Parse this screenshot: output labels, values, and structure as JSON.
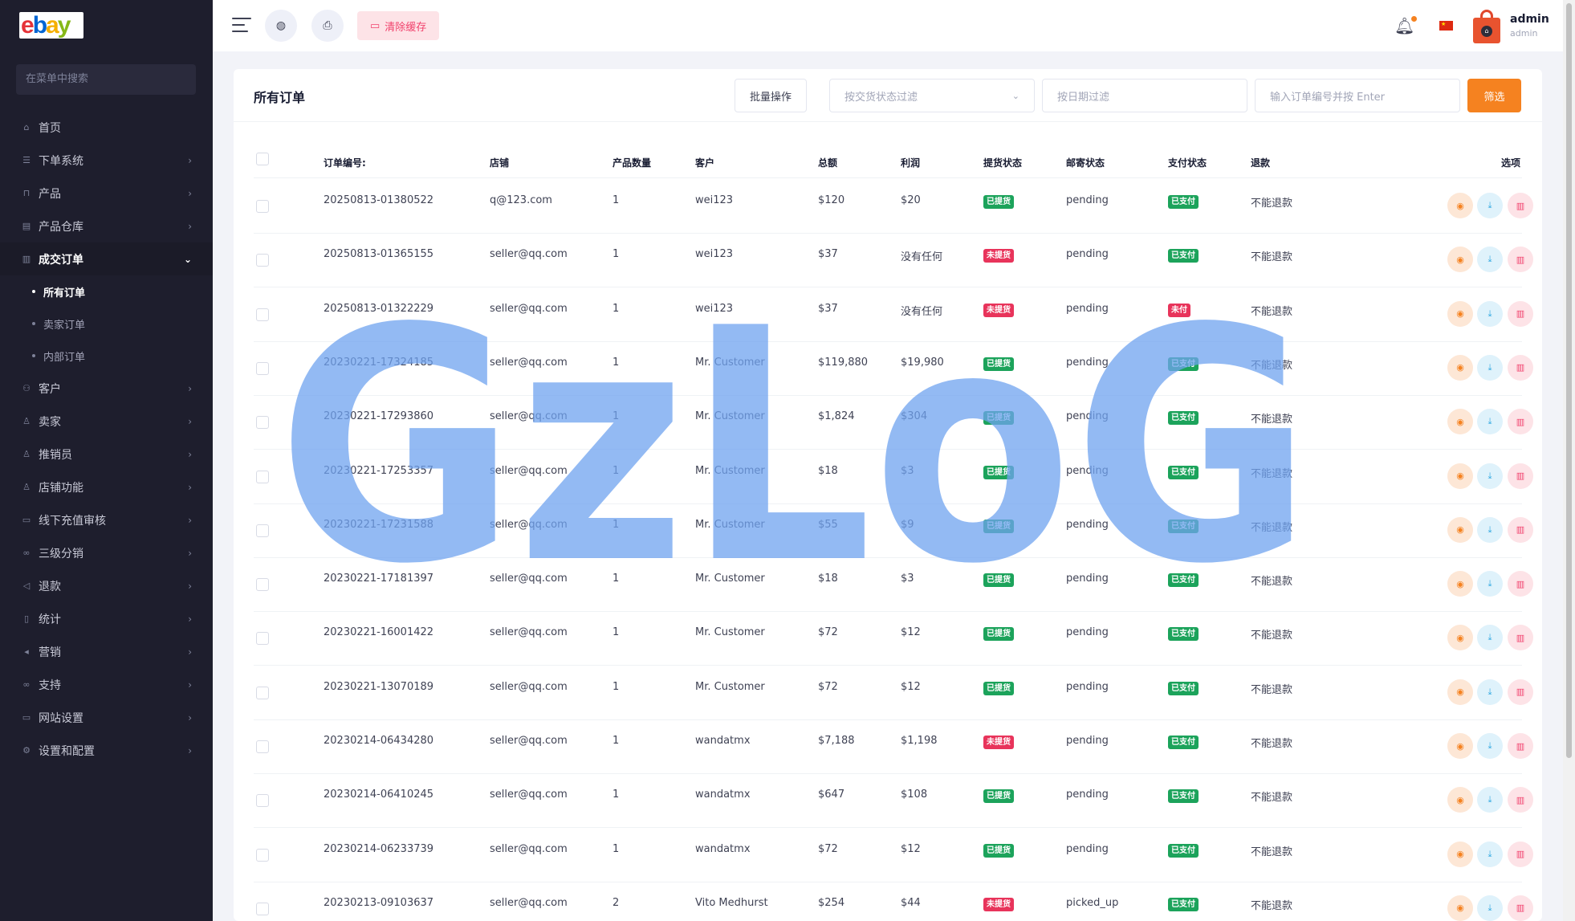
{
  "logo": {
    "e": "e",
    "b": "b",
    "a": "a",
    "y": "y"
  },
  "sidebar": {
    "search_placeholder": "在菜单中搜索",
    "items": [
      {
        "label": "首页",
        "icon": "home-icon",
        "glyph": "⌂"
      },
      {
        "label": "下单系统",
        "icon": "list-icon",
        "glyph": "☰"
      },
      {
        "label": "产品",
        "icon": "cart-icon",
        "glyph": "⊓"
      },
      {
        "label": "产品仓库",
        "icon": "warehouse-icon",
        "glyph": "▤"
      },
      {
        "label": "成交订单",
        "icon": "orders-icon",
        "glyph": "▥"
      },
      {
        "label": "所有订单"
      },
      {
        "label": "卖家订单"
      },
      {
        "label": "内部订单"
      },
      {
        "label": "客户",
        "icon": "users-icon",
        "glyph": "⚇"
      },
      {
        "label": "卖家",
        "icon": "user-icon",
        "glyph": "♙"
      },
      {
        "label": "推销员",
        "icon": "user-icon",
        "glyph": "♙"
      },
      {
        "label": "店铺功能",
        "icon": "user-icon",
        "glyph": "♙"
      },
      {
        "label": "线下充值审核",
        "icon": "id-card-icon",
        "glyph": "▭"
      },
      {
        "label": "三级分销",
        "icon": "link-icon",
        "glyph": "∞"
      },
      {
        "label": "退款",
        "icon": "refund-icon",
        "glyph": "◁"
      },
      {
        "label": "统计",
        "icon": "file-icon",
        "glyph": "▯"
      },
      {
        "label": "营销",
        "icon": "megaphone-icon",
        "glyph": "◂"
      },
      {
        "label": "支持",
        "icon": "link-icon",
        "glyph": "∞"
      },
      {
        "label": "网站设置",
        "icon": "monitor-icon",
        "glyph": "▭"
      },
      {
        "label": "设置和配置",
        "icon": "gear-icon",
        "glyph": "⚙"
      }
    ]
  },
  "header": {
    "clear_cache_label": "清除缓存",
    "user_name": "admin",
    "user_role": "admin",
    "flag_star": "★"
  },
  "card": {
    "title": "所有订单",
    "bulk_label": "批量操作",
    "delivery_filter_placeholder": "按交货状态过滤",
    "date_filter_placeholder": "按日期过滤",
    "order_search_placeholder": "输入订单编号并按 Enter",
    "filter_button": "筛选"
  },
  "table": {
    "columns": [
      "订单编号:",
      "店铺",
      "产品数量",
      "客户",
      "总额",
      "利润",
      "提货状态",
      "邮寄状态",
      "支付状态",
      "退款",
      "选项"
    ],
    "rows": [
      {
        "order": "20250813-01380522",
        "shop": "q@123.com",
        "qty": "1",
        "customer": "wei123",
        "total": "$120",
        "profit": "$20",
        "pickup": "已提货",
        "pickup_color": "green",
        "mail": "pending",
        "pay": "已支付",
        "pay_color": "green",
        "refund": "不能退款"
      },
      {
        "order": "20250813-01365155",
        "shop": "seller@qq.com",
        "qty": "1",
        "customer": "wei123",
        "total": "$37",
        "profit": "没有任何",
        "pickup": "未提货",
        "pickup_color": "red",
        "mail": "pending",
        "pay": "已支付",
        "pay_color": "green",
        "refund": "不能退款"
      },
      {
        "order": "20250813-01322229",
        "shop": "seller@qq.com",
        "qty": "1",
        "customer": "wei123",
        "total": "$37",
        "profit": "没有任何",
        "pickup": "未提货",
        "pickup_color": "red",
        "mail": "pending",
        "pay": "未付",
        "pay_color": "red",
        "refund": "不能退款"
      },
      {
        "order": "20230221-17324185",
        "shop": "seller@qq.com",
        "qty": "1",
        "customer": "Mr. Customer",
        "total": "$119,880",
        "profit": "$19,980",
        "pickup": "已提货",
        "pickup_color": "green",
        "mail": "pending",
        "pay": "已支付",
        "pay_color": "green",
        "refund": "不能退款"
      },
      {
        "order": "20230221-17293860",
        "shop": "seller@qq.com",
        "qty": "1",
        "customer": "Mr. Customer",
        "total": "$1,824",
        "profit": "$304",
        "pickup": "已提货",
        "pickup_color": "green",
        "mail": "pending",
        "pay": "已支付",
        "pay_color": "green",
        "refund": "不能退款"
      },
      {
        "order": "20230221-17253357",
        "shop": "seller@qq.com",
        "qty": "1",
        "customer": "Mr. Customer",
        "total": "$18",
        "profit": "$3",
        "pickup": "已提货",
        "pickup_color": "green",
        "mail": "pending",
        "pay": "已支付",
        "pay_color": "green",
        "refund": "不能退款"
      },
      {
        "order": "20230221-17231588",
        "shop": "seller@qq.com",
        "qty": "1",
        "customer": "Mr. Customer",
        "total": "$55",
        "profit": "$9",
        "pickup": "已提货",
        "pickup_color": "green",
        "mail": "pending",
        "pay": "已支付",
        "pay_color": "green",
        "refund": "不能退款"
      },
      {
        "order": "20230221-17181397",
        "shop": "seller@qq.com",
        "qty": "1",
        "customer": "Mr. Customer",
        "total": "$18",
        "profit": "$3",
        "pickup": "已提货",
        "pickup_color": "green",
        "mail": "pending",
        "pay": "已支付",
        "pay_color": "green",
        "refund": "不能退款"
      },
      {
        "order": "20230221-16001422",
        "shop": "seller@qq.com",
        "qty": "1",
        "customer": "Mr. Customer",
        "total": "$72",
        "profit": "$12",
        "pickup": "已提货",
        "pickup_color": "green",
        "mail": "pending",
        "pay": "已支付",
        "pay_color": "green",
        "refund": "不能退款"
      },
      {
        "order": "20230221-13070189",
        "shop": "seller@qq.com",
        "qty": "1",
        "customer": "Mr. Customer",
        "total": "$72",
        "profit": "$12",
        "pickup": "已提货",
        "pickup_color": "green",
        "mail": "pending",
        "pay": "已支付",
        "pay_color": "green",
        "refund": "不能退款"
      },
      {
        "order": "20230214-06434280",
        "shop": "seller@qq.com",
        "qty": "1",
        "customer": "wandatmx",
        "total": "$7,188",
        "profit": "$1,198",
        "pickup": "未提货",
        "pickup_color": "red",
        "mail": "pending",
        "pay": "已支付",
        "pay_color": "green",
        "refund": "不能退款"
      },
      {
        "order": "20230214-06410245",
        "shop": "seller@qq.com",
        "qty": "1",
        "customer": "wandatmx",
        "total": "$647",
        "profit": "$108",
        "pickup": "已提货",
        "pickup_color": "green",
        "mail": "pending",
        "pay": "已支付",
        "pay_color": "green",
        "refund": "不能退款"
      },
      {
        "order": "20230214-06233739",
        "shop": "seller@qq.com",
        "qty": "1",
        "customer": "wandatmx",
        "total": "$72",
        "profit": "$12",
        "pickup": "已提货",
        "pickup_color": "green",
        "mail": "pending",
        "pay": "已支付",
        "pay_color": "green",
        "refund": "不能退款"
      },
      {
        "order": "20230213-09103637",
        "shop": "seller@qq.com",
        "qty": "2",
        "customer": "Vito Medhurst",
        "total": "$254",
        "profit": "$44",
        "pickup": "未提货",
        "pickup_color": "red",
        "mail": "picked_up",
        "pay": "已支付",
        "pay_color": "green",
        "refund": "不能退款"
      }
    ]
  },
  "watermark": {
    "text": "GzLoG",
    "color": "#6fa3f0"
  },
  "colors": {
    "accent": "#f58220",
    "green": "#1ca35b",
    "red": "#e8345b",
    "sidebar_bg": "#1e1e2d"
  }
}
